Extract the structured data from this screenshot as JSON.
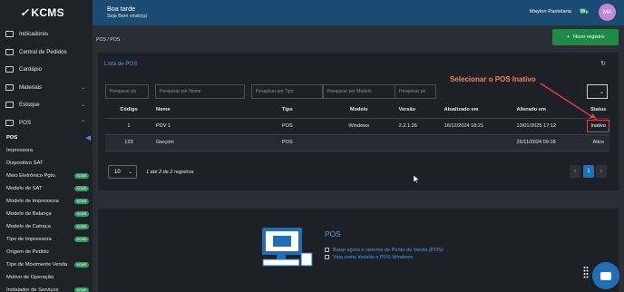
{
  "app": {
    "logo": "KCMS"
  },
  "header": {
    "greeting": "Boa tarde",
    "subgreeting": "Seja Bem vindo(a)",
    "username": "Maylon Pastelaria",
    "avatar_initials": "MA"
  },
  "sidebar": {
    "items": [
      {
        "label": "Indicadores",
        "icon": "chart-icon",
        "chevron": ""
      },
      {
        "label": "Central de Pedidos",
        "icon": "orders-icon",
        "chevron": ""
      },
      {
        "label": "Cardápio",
        "icon": "menu-book-icon",
        "chevron": ""
      },
      {
        "label": "Materiais",
        "icon": "materials-icon",
        "chevron": "⌄"
      },
      {
        "label": "Estoque",
        "icon": "stock-icon",
        "chevron": "⌄"
      },
      {
        "label": "POS",
        "icon": "pos-icon",
        "chevron": "⌃"
      }
    ],
    "subitems": [
      {
        "label": "POS",
        "badge": ""
      },
      {
        "label": "Impressora",
        "badge": ""
      },
      {
        "label": "Dispositivo SAT",
        "badge": ""
      },
      {
        "label": "Meio Eletrônico Pgto.",
        "badge": "KCMS"
      },
      {
        "label": "Modelo de SAT",
        "badge": "KCMS"
      },
      {
        "label": "Modelo de Impressora",
        "badge": "KCMS"
      },
      {
        "label": "Modelo de Balança",
        "badge": "KCMS"
      },
      {
        "label": "Modelo de Catraca",
        "badge": "KCMS"
      },
      {
        "label": "Tipo de Impressora",
        "badge": "KCMS"
      },
      {
        "label": "Origem de Pedido",
        "badge": ""
      },
      {
        "label": "Tipo de Movimento Venda",
        "badge": "KCMS"
      },
      {
        "label": "Motivo de Operação",
        "badge": ""
      },
      {
        "label": "Instalador de Serviços",
        "badge": "KCMS"
      }
    ]
  },
  "breadcrumb": "POS / POS",
  "new_button": {
    "icon": "+",
    "label": "Novo registro"
  },
  "panel": {
    "title": "Lista de POS",
    "annotation": "Selecionar o POS Inativo",
    "filters": [
      "Pesquisar po",
      "Pesquisar por Nome",
      "Pesquisar por Tipo",
      "Pesquisar por Modelo",
      "Pesquisar po"
    ],
    "columns": [
      "Código",
      "Nome",
      "Tipo",
      "Modelo",
      "Versão",
      "Atualizado em",
      "Alterado em",
      "Status"
    ],
    "rows": [
      {
        "codigo": "1",
        "nome": "PDV 1",
        "tipo": "POS",
        "modelo": "Windows",
        "versao": "2.2.1.26",
        "atualizado": "16/12/2024 18:21",
        "alterado": "13/01/2025 17:12",
        "status": "Inativo"
      },
      {
        "codigo": "123",
        "nome": "Garçom",
        "tipo": "POS",
        "modelo": "",
        "versao": "",
        "atualizado": "",
        "alterado": "25/11/2024 09:18",
        "status": "Ativo"
      }
    ],
    "page_size": "10",
    "page_info": "1 até 2 de 2 registros",
    "pager": {
      "prev": "‹",
      "current": "1",
      "next": "›"
    }
  },
  "info": {
    "title": "POS",
    "link1": "Baixe agora o sistema de Ponto de Venda (POS)",
    "link2": "Veja como instalar o POS Windows"
  },
  "colors": {
    "accent": "#1b4a72",
    "link": "#4d9de0",
    "primary_button": "#1d8a47",
    "badge": "#2f9d5b",
    "annotation": "#ff7a59"
  }
}
